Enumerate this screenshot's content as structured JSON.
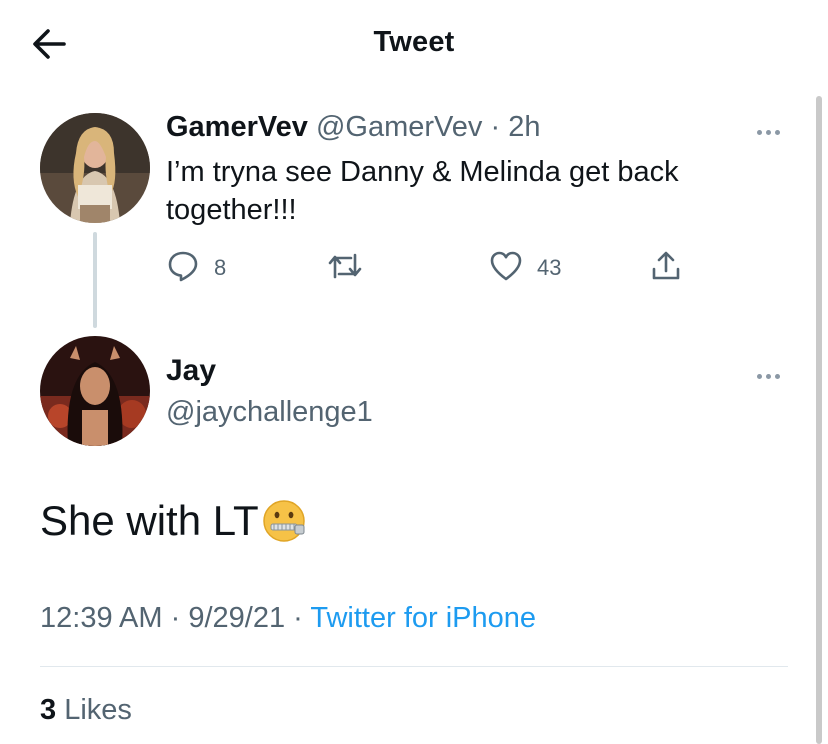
{
  "header": {
    "title": "Tweet"
  },
  "parent_tweet": {
    "display_name": "GamerVev",
    "handle": "@GamerVev",
    "separator": "·",
    "time": "2h",
    "text": "I’m tryna see Danny & Melinda get back together!!!",
    "reply_count": "8",
    "like_count": "43"
  },
  "main_tweet": {
    "display_name": "Jay",
    "handle": "@jaychallenge1",
    "text": "She with LT",
    "emoji": "zipper-mouth-face",
    "time": "12:39 AM",
    "date": "9/29/21",
    "separator": "·",
    "source": "Twitter for iPhone",
    "likes_count": "3",
    "likes_label": "Likes"
  },
  "colors": {
    "link": "#1d9bf0",
    "secondary_text": "#536471",
    "primary_text": "#0f1419"
  }
}
